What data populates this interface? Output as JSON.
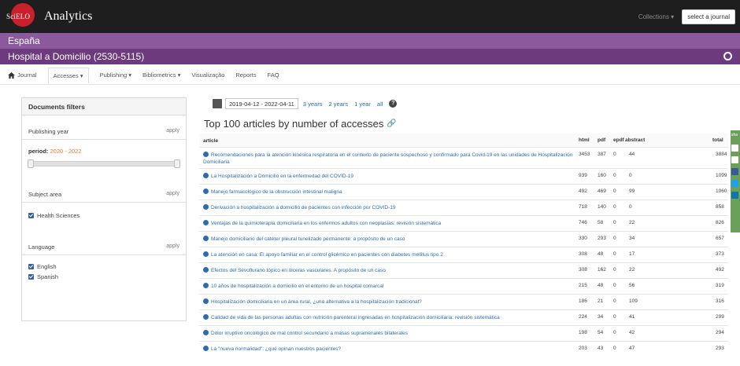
{
  "app": {
    "logo_text": "SciELO",
    "title": "Analytics"
  },
  "top": {
    "collections_label": "Collections ▾",
    "select_journal_label": "select a journal"
  },
  "country": "España",
  "journal": "Hospital a Domicilio (2530-5115)",
  "nav": {
    "items": [
      "Journal",
      "Accesses ▾",
      "Publishing ▾",
      "Bibliometrics ▾",
      "Visualização",
      "Reports",
      "FAQ"
    ]
  },
  "sidebar": {
    "title": "Documents filters",
    "publishing_year": "Publishing year",
    "apply": "apply",
    "period_label": "period:",
    "period_range": "2020 - 2022",
    "subject_area": "Subject area",
    "subject_items": [
      "Health Sciences"
    ],
    "language": "Language",
    "language_items": [
      "English",
      "Spanish"
    ]
  },
  "datebar": {
    "range": "2019-04-12 - 2022-04-11",
    "options": [
      "3 years",
      "2 years",
      "1 year",
      "all"
    ],
    "info_glyph": "?"
  },
  "section_title": "Top 100 articles by number of accesses",
  "table": {
    "headers": [
      "article",
      "html",
      "pdf",
      "epdf",
      "abstract",
      "total"
    ],
    "rows": [
      [
        "Recomendaciones para la atención kinésica respiratoria en el contexto de paciente sospechoso y confirmado para Covid-19 en las unidades de Hospitalización Domiciliaria",
        "3453",
        "387",
        "0",
        "44",
        "3884"
      ],
      [
        "La Hospitalización a Domicilio en la enfermedad del COVID-19",
        "939",
        "160",
        "0",
        "0",
        "1099"
      ],
      [
        "Manejo farmacológico de la obstrucción intestinal maligna",
        "492",
        "469",
        "0",
        "99",
        "1060"
      ],
      [
        "Derivación a hospitalización a domicilio de pacientes con infección por COVID-19",
        "718",
        "140",
        "0",
        "0",
        "858"
      ],
      [
        "Ventajas de la quimioterapia domiciliaria en los enfermos adultos con neoplasias: revisión sistemática",
        "746",
        "58",
        "0",
        "22",
        "826"
      ],
      [
        "Manejo domiciliario del catéter pleural tunelizado permanente: a propósito de un caso",
        "330",
        "293",
        "0",
        "34",
        "657"
      ],
      [
        "La atención en casa: El apoyo familiar en el control glicémico en pacientes con diabetes mellitus tipo 2",
        "308",
        "48",
        "0",
        "17",
        "373"
      ],
      [
        "Efectos del Sevoflurano tópico en úlceras vasculares. A propósito de un caso",
        "308",
        "162",
        "0",
        "22",
        "492"
      ],
      [
        "10 años de hospitalización a domicilio en el entorno de un hospital comarcal",
        "215",
        "48",
        "0",
        "56",
        "319"
      ],
      [
        "Hospitalización domiciliaria en un área rural, ¿una alternativa a la hospitalización tradicional?",
        "186",
        "21",
        "0",
        "109",
        "316"
      ],
      [
        "Calidad de vida de las personas adultas con nutrición parenteral ingresadas en hospitalización domiciliaria: revisión sistemática",
        "224",
        "34",
        "0",
        "41",
        "299"
      ],
      [
        "Dolor irruptivo oncológico de mal control secundario a masas supramenales bilaterales",
        "198",
        "54",
        "0",
        "42",
        "294"
      ],
      [
        "La \"nueva normalidad\": ¿qué opinan nuestros pacientes?",
        "203",
        "43",
        "0",
        "47",
        "293"
      ]
    ]
  },
  "share": {
    "label": "sha"
  }
}
